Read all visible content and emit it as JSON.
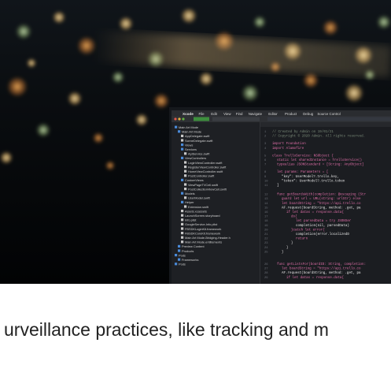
{
  "photo": {
    "alt": "Laptop screen showing Xcode with Swift code against a dark blurred bokeh background",
    "menu_bar": {
      "app": "Xcode",
      "items": [
        "File",
        "Edit",
        "View",
        "Find",
        "Navigate",
        "Editor",
        "Product",
        "Debug",
        "Source Control"
      ]
    },
    "sidebar_files": [
      "Main Art Mode",
      "Main Art Mode",
      "AppDelegate.swift",
      "SceneDelegate.swift",
      "Views",
      "Services",
      "ApiService.swift",
      "ViewControllers",
      "LoginViewController.swift",
      "RegisterViewController.swift",
      "HomeViewController.swift",
      "PostController.swift",
      "CustomViews",
      "ViewPageTVCell.swift",
      "PostCollectionViewCell.swift",
      "Models",
      "UserModel.swift",
      "Helper",
      "Extension.swift",
      "Assets.xcassets",
      "LaunchScreen.storyboard",
      "Info.plist",
      "GoogleService-Info.plist",
      "FBSDKLoginKit.framework",
      "FBSDKCoreKit.framework",
      "Main Art Mode-Bridging-Header.h",
      "Main Art Mode.entitlements",
      "Preview Content",
      "Products",
      "Pods",
      "Frameworks",
      "Pods"
    ],
    "code_lines": [
      "// Created by Admin on 19/01/21",
      "// Copyright © 2020 Admin. All rights reserved.",
      "import Foundation",
      "import Alamofire",
      "class TrelloService: NSObject {",
      "static let sharedInstance = TrelloService()",
      "typealias JSONStandard = [String: AnyObject]",
      "let params: Parameters = [",
      "\"key\": UserModel?.trello.key,",
      "\"token\": UserModel?.trello.token",
      "]",
      "func getBoardsWith(completion: @escaping (Str",
      "guard let url = URL(string: urlStr) else",
      "let boardString = \"https://api.trello.co",
      "AF.request(boardString, method: .get, pa",
      "if let datas = response.data{",
      "do{",
      "let parsedData = try JSONSer",
      "completion(nil, parsedData)",
      "}catch let error{",
      "completion(error.localizedD",
      "return",
      "}",
      "}",
      "}",
      "func getListsFor(boardID: String, completion:",
      "let boardString = \"https://api.trello.co",
      "AF.request(boardString, method: .get, pa",
      "if let datas = response.data{"
    ]
  },
  "caption": "urveillance practices, like tracking and m"
}
